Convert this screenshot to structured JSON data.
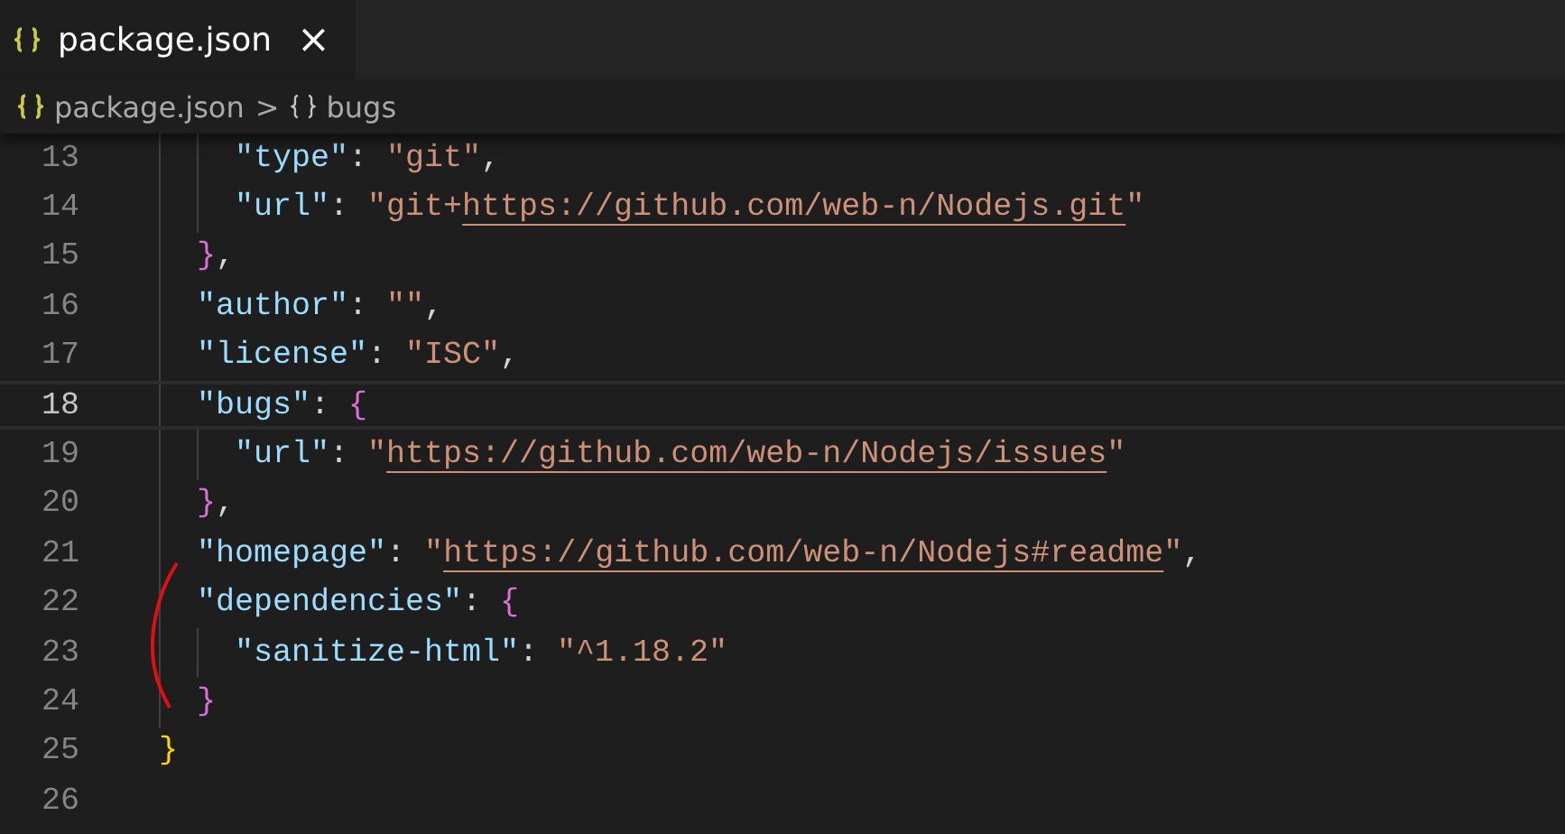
{
  "tab": {
    "label": "package.json",
    "close": "×",
    "selected": true
  },
  "breadcrumb": [
    {
      "label": "package.json",
      "kind": "file"
    },
    {
      "label": "bugs",
      "kind": "object"
    }
  ],
  "breadcrumb_separator": ">",
  "lines": [
    {
      "number": "13",
      "current": false,
      "tokens": [
        {
          "kind": "key",
          "text": "    \"type\""
        },
        {
          "kind": "punct",
          "text": ": "
        },
        {
          "kind": "string",
          "text": "\"git\""
        },
        {
          "kind": "punct",
          "text": ","
        }
      ]
    },
    {
      "number": "14",
      "current": false,
      "tokens": [
        {
          "kind": "key",
          "text": "    \"url\""
        },
        {
          "kind": "punct",
          "text": ": "
        },
        {
          "kind": "string",
          "text": "\"git+"
        },
        {
          "kind": "link",
          "text": "https://github.com/web-n/Nodejs.git"
        },
        {
          "kind": "string",
          "text": "\""
        }
      ]
    },
    {
      "number": "15",
      "current": false,
      "tokens": [
        {
          "kind": "bracket",
          "text": "  }",
          "color": "#da70d6"
        },
        {
          "kind": "punct",
          "text": ","
        }
      ]
    },
    {
      "number": "16",
      "current": false,
      "tokens": [
        {
          "kind": "key",
          "text": "  \"author\""
        },
        {
          "kind": "punct",
          "text": ": "
        },
        {
          "kind": "string",
          "text": "\"\""
        },
        {
          "kind": "punct",
          "text": ","
        }
      ]
    },
    {
      "number": "17",
      "current": false,
      "tokens": [
        {
          "kind": "key",
          "text": "  \"license\""
        },
        {
          "kind": "punct",
          "text": ": "
        },
        {
          "kind": "string",
          "text": "\"ISC\""
        },
        {
          "kind": "punct",
          "text": ","
        }
      ]
    },
    {
      "number": "18",
      "current": true,
      "tokens": [
        {
          "kind": "key",
          "text": "  \"bugs\""
        },
        {
          "kind": "punct",
          "text": ": "
        },
        {
          "kind": "bracket",
          "text": "{",
          "color": "#da70d6"
        }
      ]
    },
    {
      "number": "19",
      "current": false,
      "tokens": [
        {
          "kind": "key",
          "text": "    \"url\""
        },
        {
          "kind": "punct",
          "text": ": "
        },
        {
          "kind": "string",
          "text": "\""
        },
        {
          "kind": "link",
          "text": "https://github.com/web-n/Nodejs/issues"
        },
        {
          "kind": "string",
          "text": "\""
        }
      ]
    },
    {
      "number": "20",
      "current": false,
      "tokens": [
        {
          "kind": "bracket",
          "text": "  }",
          "color": "#da70d6"
        },
        {
          "kind": "punct",
          "text": ","
        }
      ]
    },
    {
      "number": "21",
      "current": false,
      "tokens": [
        {
          "kind": "key",
          "text": "  \"homepage\""
        },
        {
          "kind": "punct",
          "text": ": "
        },
        {
          "kind": "string",
          "text": "\""
        },
        {
          "kind": "link",
          "text": "https://github.com/web-n/Nodejs#readme"
        },
        {
          "kind": "string",
          "text": "\""
        },
        {
          "kind": "punct",
          "text": ","
        }
      ]
    },
    {
      "number": "22",
      "current": false,
      "tokens": [
        {
          "kind": "key",
          "text": "  \"dependencies\""
        },
        {
          "kind": "punct",
          "text": ": "
        },
        {
          "kind": "bracket",
          "text": "{",
          "color": "#da70d6"
        }
      ]
    },
    {
      "number": "23",
      "current": false,
      "tokens": [
        {
          "kind": "key",
          "text": "    \"sanitize-html\""
        },
        {
          "kind": "punct",
          "text": ": "
        },
        {
          "kind": "string",
          "text": "\"^1.18.2\""
        }
      ]
    },
    {
      "number": "24",
      "current": false,
      "tokens": [
        {
          "kind": "bracket",
          "text": "  }",
          "color": "#da70d6"
        }
      ]
    },
    {
      "number": "25",
      "current": false,
      "tokens": [
        {
          "kind": "bracket",
          "text": "}",
          "color": "#ffd700"
        }
      ]
    },
    {
      "number": "26",
      "current": false
    }
  ]
}
